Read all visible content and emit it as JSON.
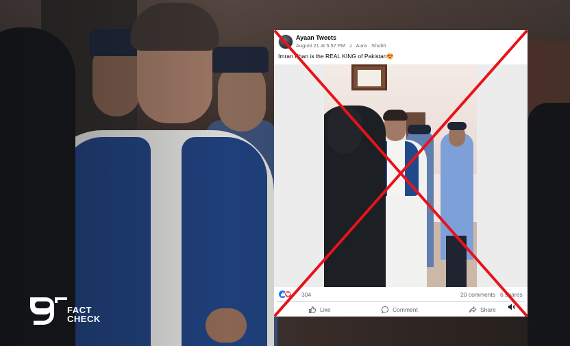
{
  "post": {
    "author": "Ayaan Tweets",
    "date": "August 21 at 5:57 PM",
    "audio_icon": "♫",
    "audio": "Aura · Shubh",
    "more": "···",
    "caption": "Imran Khan is the REAL KING of Pakistan😍",
    "reactions_count": "304",
    "comments": "20 comments",
    "shares": "6 shares",
    "actions": {
      "like": "Like",
      "comment": "Comment",
      "share": "Share"
    },
    "icons": {
      "like": "thumbs-up-icon",
      "comment": "speech-bubble-icon",
      "share": "share-arrow-icon",
      "volume": "speaker-icon"
    }
  },
  "overlay": {
    "stamp": "red-x-cross",
    "stamp_color": "#e8131a"
  },
  "logo": {
    "numeral": "9",
    "line1": "FACT",
    "line2": "CHECK",
    "color": "#ffffff"
  }
}
